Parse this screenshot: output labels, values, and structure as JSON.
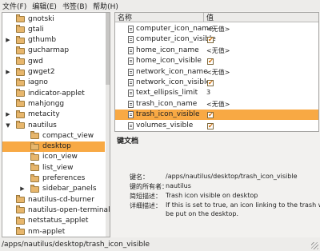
{
  "menubar": [
    "文件(F)",
    "编辑(E)",
    "书签(B)",
    "帮助(H)"
  ],
  "tree": {
    "rows": [
      {
        "label": "gnotski",
        "indent": 0,
        "expander": "",
        "selected": false
      },
      {
        "label": "gtali",
        "indent": 0,
        "expander": "",
        "selected": false
      },
      {
        "label": "gthumb",
        "indent": 0,
        "expander": "▶",
        "selected": false
      },
      {
        "label": "gucharmap",
        "indent": 0,
        "expander": "",
        "selected": false
      },
      {
        "label": "gwd",
        "indent": 0,
        "expander": "",
        "selected": false
      },
      {
        "label": "gwget2",
        "indent": 0,
        "expander": "▶",
        "selected": false
      },
      {
        "label": "iagno",
        "indent": 0,
        "expander": "",
        "selected": false
      },
      {
        "label": "indicator-applet",
        "indent": 0,
        "expander": "",
        "selected": false
      },
      {
        "label": "mahjongg",
        "indent": 0,
        "expander": "",
        "selected": false
      },
      {
        "label": "metacity",
        "indent": 0,
        "expander": "▶",
        "selected": false
      },
      {
        "label": "nautilus",
        "indent": 0,
        "expander": "▼",
        "selected": false
      },
      {
        "label": "compact_view",
        "indent": 1,
        "expander": "",
        "selected": false
      },
      {
        "label": "desktop",
        "indent": 1,
        "expander": "",
        "selected": true
      },
      {
        "label": "icon_view",
        "indent": 1,
        "expander": "",
        "selected": false
      },
      {
        "label": "list_view",
        "indent": 1,
        "expander": "",
        "selected": false
      },
      {
        "label": "preferences",
        "indent": 1,
        "expander": "",
        "selected": false
      },
      {
        "label": "sidebar_panels",
        "indent": 1,
        "expander": "▶",
        "selected": false
      },
      {
        "label": "nautilus-cd-burner",
        "indent": 0,
        "expander": "",
        "selected": false
      },
      {
        "label": "nautilus-open-terminal",
        "indent": 0,
        "expander": "",
        "selected": false
      },
      {
        "label": "netstatus_applet",
        "indent": 0,
        "expander": "",
        "selected": false
      },
      {
        "label": "nm-applet",
        "indent": 0,
        "expander": "",
        "selected": false
      }
    ]
  },
  "keys": {
    "col_name": "名称",
    "col_value": "值",
    "rows": [
      {
        "name": "computer_icon_name",
        "type": "text",
        "value": "<无值>",
        "selected": false
      },
      {
        "name": "computer_icon_visible",
        "type": "bool",
        "value": "✔",
        "selected": false
      },
      {
        "name": "home_icon_name",
        "type": "text",
        "value": "<无值>",
        "selected": false
      },
      {
        "name": "home_icon_visible",
        "type": "bool",
        "value": "✔",
        "selected": false
      },
      {
        "name": "network_icon_name",
        "type": "text",
        "value": "<无值>",
        "selected": false
      },
      {
        "name": "network_icon_visible",
        "type": "bool",
        "value": "✔",
        "selected": false
      },
      {
        "name": "text_ellipsis_limit",
        "type": "text",
        "value": "3",
        "selected": false
      },
      {
        "name": "trash_icon_name",
        "type": "text",
        "value": "<无值>",
        "selected": false
      },
      {
        "name": "trash_icon_visible",
        "type": "bool",
        "value": "✔",
        "selected": true
      },
      {
        "name": "volumes_visible",
        "type": "bool",
        "value": "✔",
        "selected": false
      }
    ]
  },
  "docs": {
    "title": "键文档",
    "key_label": "键名：",
    "key_value": "/apps/nautilus/desktop/trash_icon_visible",
    "owner_label": "键的所有者：",
    "owner_value": "nautilus",
    "short_label": "简短描述：",
    "short_value": "Trash icon visible on desktop",
    "long_label": "详细描述：",
    "long_value_1": "If this is set to true, an icon linking to the trash will",
    "long_value_2": "be put on the desktop."
  },
  "statusbar": "/apps/nautilus/desktop/trash_icon_visible",
  "colors": {
    "selection": "#f8a944"
  }
}
